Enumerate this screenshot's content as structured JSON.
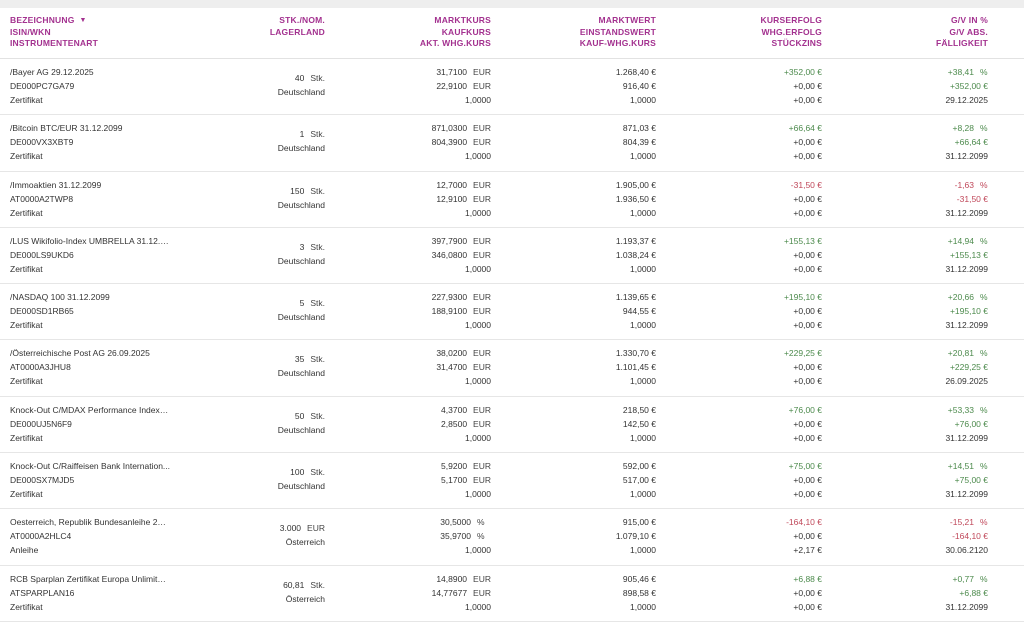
{
  "colors": {
    "header": "#a3318f",
    "positive": "#4c8a4c",
    "negative": "#c0485a"
  },
  "header": {
    "col1": [
      "BEZEICHNUNG",
      "ISIN/WKN",
      "INSTRUMENTENART"
    ],
    "col2": [
      "STK./NOM.",
      "LAGERLAND"
    ],
    "col3": [
      "MARKTKURS",
      "KAUFKURS",
      "AKT. WHG.KURS"
    ],
    "col4": [
      "MARKTWERT",
      "EINSTANDSWERT",
      "KAUF-WHG.KURS"
    ],
    "col5": [
      "KURSERFOLG",
      "WHG.ERFOLG",
      "STÜCKZINS"
    ],
    "col6": [
      "G/V IN %",
      "G/V ABS.",
      "FÄLLIGKEIT"
    ],
    "sort_icon": "sort-down-icon",
    "sort_glyph": "▼"
  },
  "rows": [
    {
      "name": "/Bayer AG 29.12.2025",
      "isin": "DE000PC7GA79",
      "type": "Zertifikat",
      "qty": "40",
      "qty_unit": "Stk.",
      "country": "Deutschland",
      "market_price": "31,7100",
      "buy_price": "22,9100",
      "price_unit": "EUR",
      "fx": "1,0000",
      "market_value": "1.268,40 €",
      "cost_value": "916,40 €",
      "buy_fx": "1,0000",
      "price_result": "+352,00 €",
      "price_result_sign": "pos",
      "fx_result": "+0,00 €",
      "fx_result_sign": "neu",
      "accrued": "+0,00 €",
      "accrued_sign": "neu",
      "pl_pct": "+38,41",
      "pl_pct_sign": "pos",
      "pl_abs": "+352,00 €",
      "pl_abs_sign": "pos",
      "maturity": "29.12.2025"
    },
    {
      "name": "/Bitcoin BTC/EUR 31.12.2099",
      "isin": "DE000VX3XBT9",
      "type": "Zertifikat",
      "qty": "1",
      "qty_unit": "Stk.",
      "country": "Deutschland",
      "market_price": "871,0300",
      "buy_price": "804,3900",
      "price_unit": "EUR",
      "fx": "1,0000",
      "market_value": "871,03 €",
      "cost_value": "804,39 €",
      "buy_fx": "1,0000",
      "price_result": "+66,64 €",
      "price_result_sign": "pos",
      "fx_result": "+0,00 €",
      "fx_result_sign": "neu",
      "accrued": "+0,00 €",
      "accrued_sign": "neu",
      "pl_pct": "+8,28",
      "pl_pct_sign": "pos",
      "pl_abs": "+66,64 €",
      "pl_abs_sign": "pos",
      "maturity": "31.12.2099"
    },
    {
      "name": "/Immoaktien 31.12.2099",
      "isin": "AT0000A2TWP8",
      "type": "Zertifikat",
      "qty": "150",
      "qty_unit": "Stk.",
      "country": "Deutschland",
      "market_price": "12,7000",
      "buy_price": "12,9100",
      "price_unit": "EUR",
      "fx": "1,0000",
      "market_value": "1.905,00 €",
      "cost_value": "1.936,50 €",
      "buy_fx": "1,0000",
      "price_result": "-31,50 €",
      "price_result_sign": "neg",
      "fx_result": "+0,00 €",
      "fx_result_sign": "neu",
      "accrued": "+0,00 €",
      "accrued_sign": "neu",
      "pl_pct": "-1,63",
      "pl_pct_sign": "neg",
      "pl_abs": "-31,50 €",
      "pl_abs_sign": "neg",
      "maturity": "31.12.2099"
    },
    {
      "name": "/LUS Wikifolio-Index UMBRELLA 31.12.20...",
      "isin": "DE000LS9UKD6",
      "type": "Zertifikat",
      "qty": "3",
      "qty_unit": "Stk.",
      "country": "Deutschland",
      "market_price": "397,7900",
      "buy_price": "346,0800",
      "price_unit": "EUR",
      "fx": "1,0000",
      "market_value": "1.193,37 €",
      "cost_value": "1.038,24 €",
      "buy_fx": "1,0000",
      "price_result": "+155,13 €",
      "price_result_sign": "pos",
      "fx_result": "+0,00 €",
      "fx_result_sign": "neu",
      "accrued": "+0,00 €",
      "accrued_sign": "neu",
      "pl_pct": "+14,94",
      "pl_pct_sign": "pos",
      "pl_abs": "+155,13 €",
      "pl_abs_sign": "pos",
      "maturity": "31.12.2099"
    },
    {
      "name": "/NASDAQ 100 31.12.2099",
      "isin": "DE000SD1RB65",
      "type": "Zertifikat",
      "qty": "5",
      "qty_unit": "Stk.",
      "country": "Deutschland",
      "market_price": "227,9300",
      "buy_price": "188,9100",
      "price_unit": "EUR",
      "fx": "1,0000",
      "market_value": "1.139,65 €",
      "cost_value": "944,55 €",
      "buy_fx": "1,0000",
      "price_result": "+195,10 €",
      "price_result_sign": "pos",
      "fx_result": "+0,00 €",
      "fx_result_sign": "neu",
      "accrued": "+0,00 €",
      "accrued_sign": "neu",
      "pl_pct": "+20,66",
      "pl_pct_sign": "pos",
      "pl_abs": "+195,10 €",
      "pl_abs_sign": "pos",
      "maturity": "31.12.2099"
    },
    {
      "name": "/Österreichische Post AG 26.09.2025",
      "isin": "AT0000A3JHU8",
      "type": "Zertifikat",
      "qty": "35",
      "qty_unit": "Stk.",
      "country": "Deutschland",
      "market_price": "38,0200",
      "buy_price": "31,4700",
      "price_unit": "EUR",
      "fx": "1,0000",
      "market_value": "1.330,70 €",
      "cost_value": "1.101,45 €",
      "buy_fx": "1,0000",
      "price_result": "+229,25 €",
      "price_result_sign": "pos",
      "fx_result": "+0,00 €",
      "fx_result_sign": "neu",
      "accrued": "+0,00 €",
      "accrued_sign": "neu",
      "pl_pct": "+20,81",
      "pl_pct_sign": "pos",
      "pl_abs": "+229,25 €",
      "pl_abs_sign": "pos",
      "maturity": "26.09.2025"
    },
    {
      "name": "Knock-Out C/MDAX Performance Index E...",
      "isin": "DE000UJ5N6F9",
      "type": "Zertifikat",
      "qty": "50",
      "qty_unit": "Stk.",
      "country": "Deutschland",
      "market_price": "4,3700",
      "buy_price": "2,8500",
      "price_unit": "EUR",
      "fx": "1,0000",
      "market_value": "218,50 €",
      "cost_value": "142,50 €",
      "buy_fx": "1,0000",
      "price_result": "+76,00 €",
      "price_result_sign": "pos",
      "fx_result": "+0,00 €",
      "fx_result_sign": "neu",
      "accrued": "+0,00 €",
      "accrued_sign": "neu",
      "pl_pct": "+53,33",
      "pl_pct_sign": "pos",
      "pl_abs": "+76,00 €",
      "pl_abs_sign": "pos",
      "maturity": "31.12.2099"
    },
    {
      "name": "Knock-Out C/Raiffeisen Bank Internation...",
      "isin": "DE000SX7MJD5",
      "type": "Zertifikat",
      "qty": "100",
      "qty_unit": "Stk.",
      "country": "Deutschland",
      "market_price": "5,9200",
      "buy_price": "5,1700",
      "price_unit": "EUR",
      "fx": "1,0000",
      "market_value": "592,00 €",
      "cost_value": "517,00 €",
      "buy_fx": "1,0000",
      "price_result": "+75,00 €",
      "price_result_sign": "pos",
      "fx_result": "+0,00 €",
      "fx_result_sign": "neu",
      "accrued": "+0,00 €",
      "accrued_sign": "neu",
      "pl_pct": "+14,51",
      "pl_pct_sign": "pos",
      "pl_abs": "+75,00 €",
      "pl_abs_sign": "pos",
      "maturity": "31.12.2099"
    },
    {
      "name": "Oesterreich, Republik Bundesanleihe 202...",
      "isin": "AT0000A2HLC4",
      "type": "Anleihe",
      "qty": "3.000",
      "qty_unit": "EUR",
      "country": "Österreich",
      "market_price": "30,5000",
      "buy_price": "35,9700",
      "price_unit": "%",
      "fx": "1,0000",
      "market_value": "915,00 €",
      "cost_value": "1.079,10 €",
      "buy_fx": "1,0000",
      "price_result": "-164,10 €",
      "price_result_sign": "neg",
      "fx_result": "+0,00 €",
      "fx_result_sign": "neu",
      "accrued": "+2,17 €",
      "accrued_sign": "neu",
      "pl_pct": "-15,21",
      "pl_pct_sign": "neg",
      "pl_abs": "-164,10 €",
      "pl_abs_sign": "neg",
      "maturity": "30.06.2120"
    },
    {
      "name": "RCB Sparplan Zertifikat Europa Unlimited ...",
      "isin": "ATSPARPLAN16",
      "type": "Zertifikat",
      "qty": "60,81",
      "qty_unit": "Stk.",
      "country": "Österreich",
      "market_price": "14,8900",
      "buy_price": "14,77677",
      "price_unit": "EUR",
      "fx": "1,0000",
      "market_value": "905,46 €",
      "cost_value": "898,58 €",
      "buy_fx": "1,0000",
      "price_result": "+6,88 €",
      "price_result_sign": "pos",
      "fx_result": "+0,00 €",
      "fx_result_sign": "neu",
      "accrued": "+0,00 €",
      "accrued_sign": "neu",
      "pl_pct": "+0,77",
      "pl_pct_sign": "pos",
      "pl_abs": "+6,88 €",
      "pl_abs_sign": "pos",
      "maturity": "31.12.2099"
    }
  ]
}
